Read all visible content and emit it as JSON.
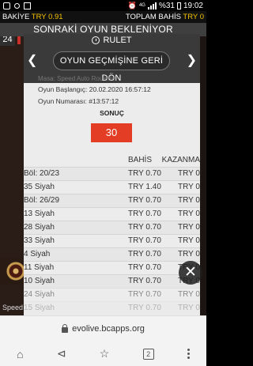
{
  "status_bar": {
    "time": "19:02",
    "battery": "%31",
    "network": "4G",
    "icons": [
      "signal-bars-icon",
      "vpn-key-icon",
      "notification-icon",
      "mail-icon",
      "alarm-icon",
      "wifi-icon",
      "battery-icon"
    ]
  },
  "balance": {
    "label": "BAKİYE",
    "value": "TRY 0.91",
    "total_bet_label": "TOPLAM BAHİS",
    "total_bet_value": "TRY 0"
  },
  "game": {
    "header": "SONRAKİ OYUN BEKLENİYOR",
    "round_number": "24",
    "speed_label": "Speed"
  },
  "modal": {
    "title": "RULET",
    "history_button": "OYUN GEÇMİŞİNE GERİ DÖN",
    "faded_title": "Masa: Speed Auto Roulette",
    "start_label": "Oyun Başlangıç:",
    "start_value": "20.02.2020 16:57:12",
    "number_label": "Oyun Numarası:",
    "number_value": "#13:57:12",
    "result_label": "SONUÇ",
    "result_value": "30",
    "columns": {
      "bet": "BAHİS",
      "win": "KAZANMA"
    },
    "bets": [
      {
        "name": "Böl: 20/23",
        "bet": "TRY 0.70",
        "win": "TRY 0"
      },
      {
        "name": "35 Siyah",
        "bet": "TRY 1.40",
        "win": "TRY 0"
      },
      {
        "name": "Böl: 26/29",
        "bet": "TRY 0.70",
        "win": "TRY 0"
      },
      {
        "name": "13 Siyah",
        "bet": "TRY 0.70",
        "win": "TRY 0"
      },
      {
        "name": "28 Siyah",
        "bet": "TRY 0.70",
        "win": "TRY 0"
      },
      {
        "name": "33 Siyah",
        "bet": "TRY 0.70",
        "win": "TRY 0"
      },
      {
        "name": "4 Siyah",
        "bet": "TRY 0.70",
        "win": "TRY 0"
      },
      {
        "name": "11 Siyah",
        "bet": "TRY 0.70",
        "win": "TRY 0"
      },
      {
        "name": "10 Siyah",
        "bet": "TRY 0.70",
        "win": "TRY 0"
      },
      {
        "name": "24 Siyah",
        "bet": "TRY 0.70",
        "win": "TRY 0"
      },
      {
        "name": "15 Siyah",
        "bet": "TRY 0.70",
        "win": "TRY 0"
      }
    ],
    "close_icon": "close-icon"
  },
  "browser": {
    "url": "evolive.bcapps.org",
    "tab_count": "2"
  },
  "colors": {
    "accent_yellow": "#f2c200",
    "result_red": "#e33d25",
    "modal_bg": "#ececec",
    "header_dark": "#3a3a3a"
  }
}
